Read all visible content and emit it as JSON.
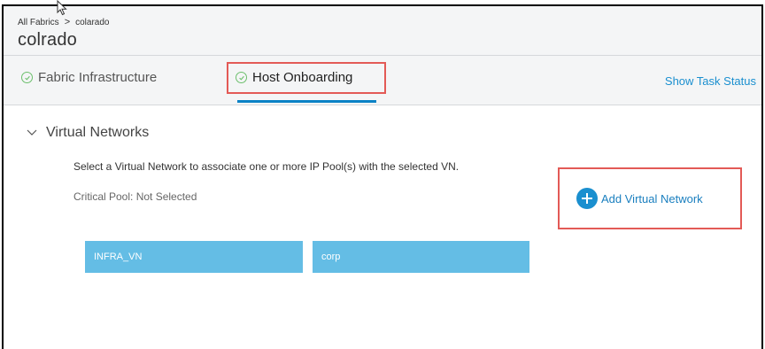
{
  "breadcrumb": {
    "root": "All Fabrics",
    "separator": ">",
    "current": "colarado"
  },
  "page_title": "colrado",
  "tabs": [
    {
      "label": "Fabric Infrastructure",
      "icon": "check-circle-icon",
      "active": false
    },
    {
      "label": "Host Onboarding",
      "icon": "check-circle-icon",
      "active": true
    }
  ],
  "task_status_link": "Show Task Status",
  "section": {
    "title": "Virtual Networks",
    "expanded": true,
    "help_text": "Select a Virtual Network to associate one or more IP Pool(s) with the selected VN.",
    "critical_pool": "Critical Pool: Not Selected",
    "add_button": "Add Virtual Network",
    "add_icon": "plus-circle-icon",
    "networks": [
      {
        "label": "INFRA_VN"
      },
      {
        "label": "corp"
      }
    ]
  },
  "colors": {
    "accent": "#0b82c6",
    "card": "#64bde5",
    "highlight": "#e35a56",
    "success": "#6cbf6c"
  }
}
